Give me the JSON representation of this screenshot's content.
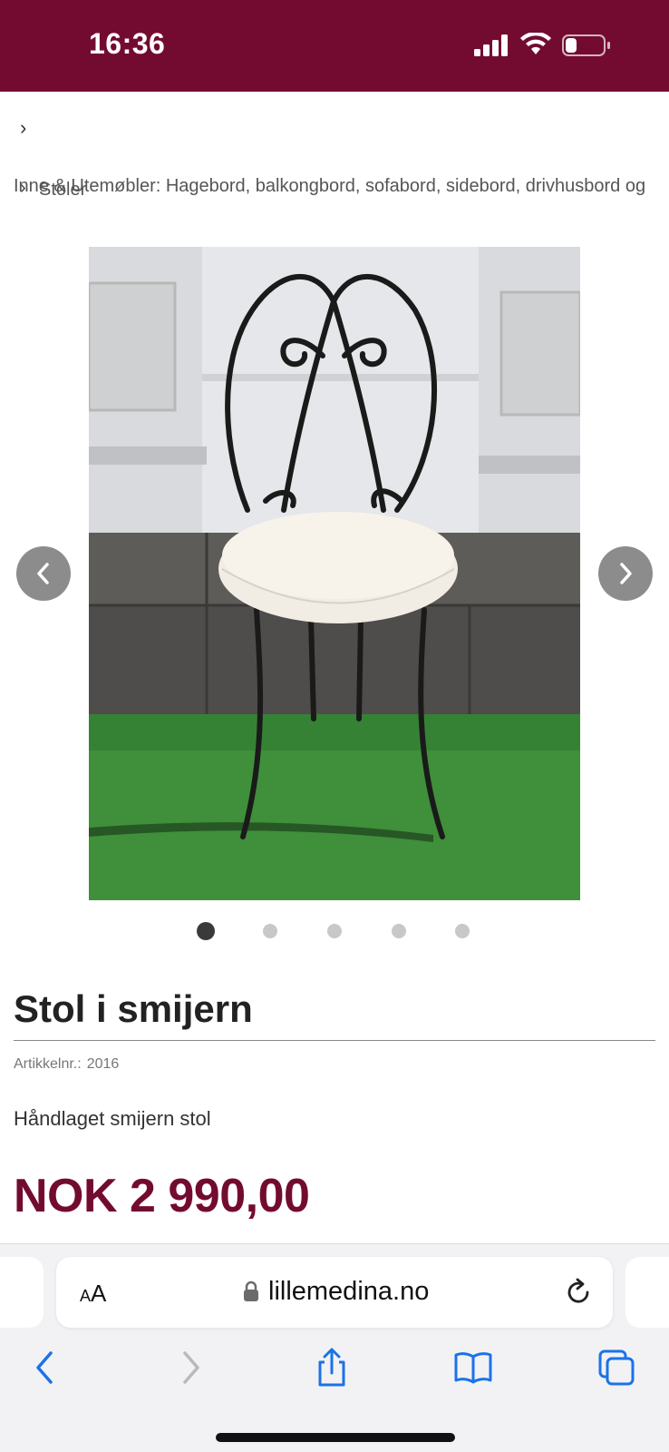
{
  "status_bar": {
    "time": "16:36",
    "battery_level": 0.3
  },
  "breadcrumb": {
    "chevron": "›",
    "line_a": "Inne & Utemøbler: Hagebord, balkongbord, sofabord, sidebord, drivhusbord og",
    "line_b": "Stoler"
  },
  "gallery": {
    "image_count": 5,
    "active_index": 0
  },
  "product": {
    "title": "Stol i smijern",
    "sku_label": "Artikkelnr.:",
    "sku_value": "2016",
    "description": "Håndlaget smijern stol",
    "price": "NOK 2 990,00"
  },
  "browser": {
    "text_size_label_small": "A",
    "text_size_label_large": "A",
    "url": "lillemedina.no"
  },
  "colors": {
    "brand": "#730b30",
    "ui_blue": "#1a73e8"
  }
}
